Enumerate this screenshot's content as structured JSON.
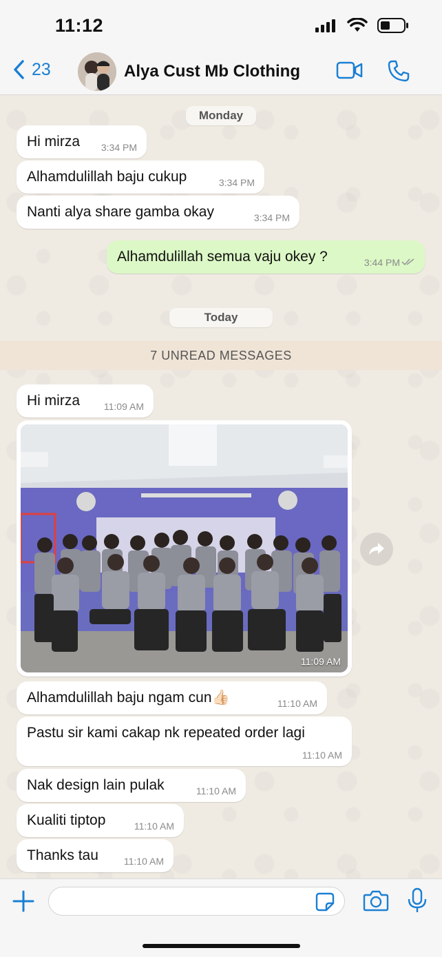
{
  "status_bar": {
    "time": "11:12"
  },
  "header": {
    "back_count": "23",
    "title": "Alya Cust Mb Clothing"
  },
  "dates": {
    "monday": "Monday",
    "today": "Today"
  },
  "unread": "7 UNREAD MESSAGES",
  "messages": [
    {
      "dir": "in",
      "text": "Hi mirza",
      "time": "3:34 PM"
    },
    {
      "dir": "in",
      "text": "Alhamdulillah baju cukup",
      "time": "3:34 PM"
    },
    {
      "dir": "in",
      "text": "Nanti alya share gamba okay",
      "time": "3:34 PM"
    },
    {
      "dir": "out",
      "text": "Alhamdulillah semua vaju okey ?",
      "time": "3:44 PM"
    },
    {
      "dir": "in",
      "text": "Hi mirza",
      "time": "11:09 AM"
    },
    {
      "dir": "in",
      "text": "Alhamdulillah baju ngam cun👍🏻",
      "time": "11:10 AM"
    },
    {
      "dir": "in",
      "text": "Pastu sir kami cakap nk repeated order lagi",
      "time": "11:10 AM"
    },
    {
      "dir": "in",
      "text": "Nak design lain pulak",
      "time": "11:10 AM"
    },
    {
      "dir": "in",
      "text": "Kualiti tiptop",
      "time": "11:10 AM"
    },
    {
      "dir": "in",
      "text": "Thanks tau",
      "time": "11:10 AM"
    }
  ],
  "photo_message": {
    "time": "11:09 AM"
  },
  "icons": {
    "back": "chevron-left-icon",
    "video": "video-camera-icon",
    "call": "phone-icon",
    "forward": "forward-icon",
    "add": "plus-icon",
    "sticker": "sticker-icon",
    "camera": "camera-icon",
    "mic": "microphone-icon"
  },
  "colors": {
    "accent": "#1a7fd4",
    "outgoing_bubble": "#dcf8c6",
    "incoming_bubble": "#ffffff",
    "chat_bg": "#efeae2"
  }
}
